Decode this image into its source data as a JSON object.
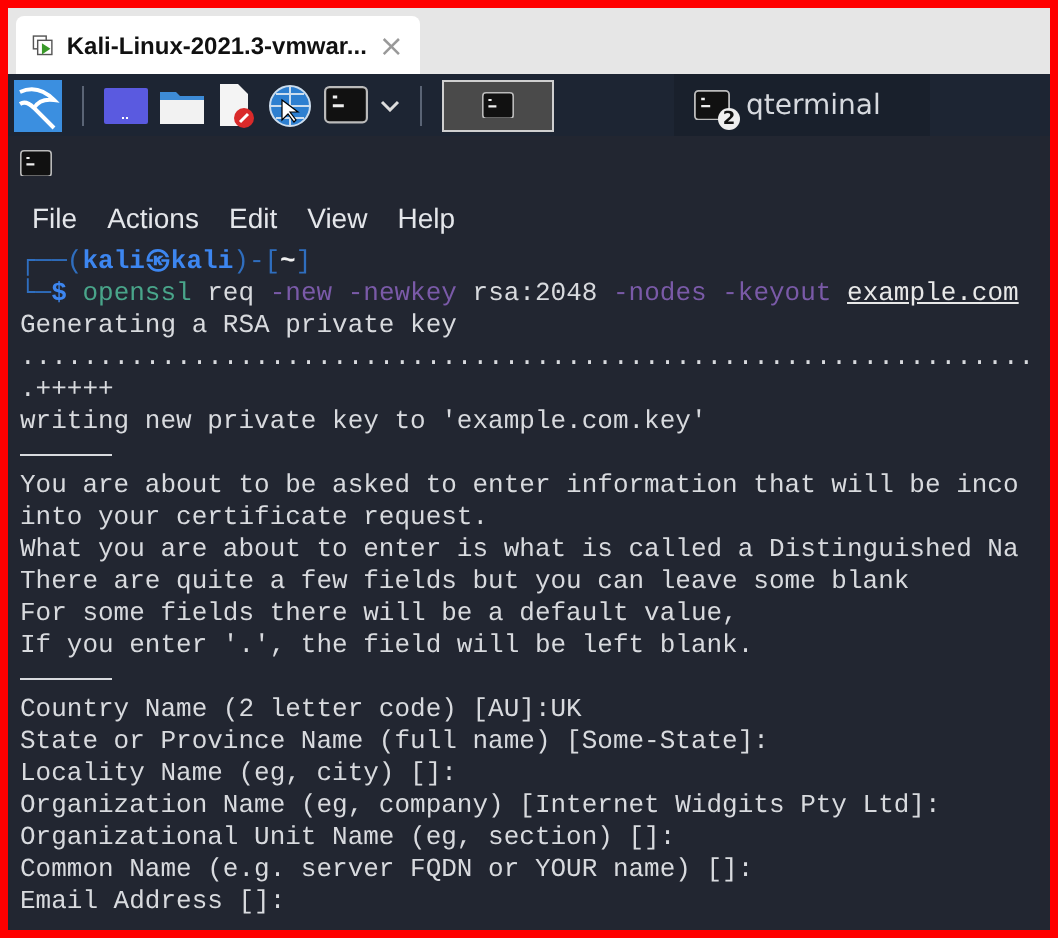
{
  "browser_tab": {
    "title": "Kali-Linux-2021.3-vmwar...",
    "close": "×"
  },
  "taskbar": {
    "active_window": {
      "selected": true
    },
    "task": {
      "label": "qterminal",
      "badge": "2"
    }
  },
  "menu": [
    "File",
    "Actions",
    "Edit",
    "View",
    "Help"
  ],
  "terminal_lines": [
    {
      "kind": "text",
      "spans": [
        {
          "kind": "frame",
          "text": "┌──("
        },
        {
          "kind": "user",
          "text": "kali㉿kali"
        },
        {
          "kind": "frame",
          "text": ")-["
        },
        {
          "kind": "dir",
          "text": "~"
        },
        {
          "kind": "frame",
          "text": "]"
        }
      ]
    },
    {
      "kind": "text",
      "spans": [
        {
          "kind": "frame",
          "text": "└─"
        },
        {
          "kind": "user",
          "text": "$ "
        },
        {
          "kind": "cmd",
          "text": "openssl"
        },
        {
          "kind": "plain",
          "text": " req "
        },
        {
          "kind": "opt",
          "text": "-new -newkey"
        },
        {
          "kind": "plain",
          "text": " rsa:2048 "
        },
        {
          "kind": "opt",
          "text": "-nodes -keyout "
        },
        {
          "kind": "path",
          "text": "example.com"
        }
      ]
    },
    {
      "kind": "text",
      "spans": [
        {
          "kind": "plain",
          "text": "Generating a RSA private key"
        }
      ]
    },
    {
      "kind": "text",
      "spans": [
        {
          "kind": "plain",
          "text": "................................................................."
        }
      ]
    },
    {
      "kind": "text",
      "spans": [
        {
          "kind": "plain",
          "text": ".+++++"
        }
      ]
    },
    {
      "kind": "text",
      "spans": [
        {
          "kind": "plain",
          "text": "writing new private key to 'example.com.key'"
        }
      ]
    },
    {
      "kind": "rule"
    },
    {
      "kind": "text",
      "spans": [
        {
          "kind": "plain",
          "text": "You are about to be asked to enter information that will be inco"
        }
      ]
    },
    {
      "kind": "text",
      "spans": [
        {
          "kind": "plain",
          "text": "into your certificate request."
        }
      ]
    },
    {
      "kind": "text",
      "spans": [
        {
          "kind": "plain",
          "text": "What you are about to enter is what is called a Distinguished Na"
        }
      ]
    },
    {
      "kind": "text",
      "spans": [
        {
          "kind": "plain",
          "text": "There are quite a few fields but you can leave some blank"
        }
      ]
    },
    {
      "kind": "text",
      "spans": [
        {
          "kind": "plain",
          "text": "For some fields there will be a default value,"
        }
      ]
    },
    {
      "kind": "text",
      "spans": [
        {
          "kind": "plain",
          "text": "If you enter '.', the field will be left blank."
        }
      ]
    },
    {
      "kind": "rule"
    },
    {
      "kind": "text",
      "spans": [
        {
          "kind": "plain",
          "text": "Country Name (2 letter code) [AU]:UK"
        }
      ]
    },
    {
      "kind": "text",
      "spans": [
        {
          "kind": "plain",
          "text": "State or Province Name (full name) [Some-State]:"
        }
      ]
    },
    {
      "kind": "text",
      "spans": [
        {
          "kind": "plain",
          "text": "Locality Name (eg, city) []:"
        }
      ]
    },
    {
      "kind": "text",
      "spans": [
        {
          "kind": "plain",
          "text": "Organization Name (eg, company) [Internet Widgits Pty Ltd]:"
        }
      ]
    },
    {
      "kind": "text",
      "spans": [
        {
          "kind": "plain",
          "text": "Organizational Unit Name (eg, section) []:"
        }
      ]
    },
    {
      "kind": "text",
      "spans": [
        {
          "kind": "plain",
          "text": "Common Name (e.g. server FQDN or YOUR name) []:"
        }
      ]
    },
    {
      "kind": "text",
      "spans": [
        {
          "kind": "plain",
          "text": "Email Address []:"
        }
      ]
    }
  ]
}
